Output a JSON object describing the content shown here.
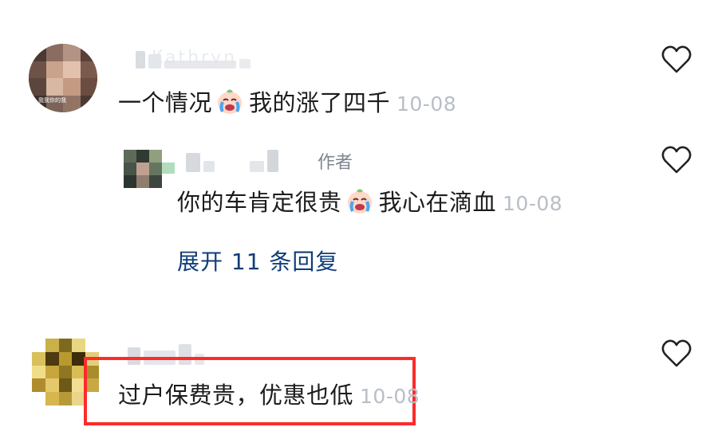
{
  "comments": [
    {
      "username": "Kathryn",
      "text": "一个情况",
      "emoji": "crying-face",
      "text_after": "我的涨了四千",
      "time": "10-08",
      "avatar_caption": "我我你的我"
    },
    {
      "author_label": "作者",
      "text": "你的车肯定很贵",
      "emoji": "crying-face",
      "text_after": "我心在滴血",
      "time": "10-08",
      "expand_label": "展开 11 条回复"
    },
    {
      "text": "过户保费贵，优惠也低",
      "time": "10-08"
    }
  ],
  "colors": {
    "text": "#1c1c1c",
    "timestamp": "#b9bec6",
    "link": "#0f3d78",
    "highlight": "#ff2a2a"
  },
  "icons": [
    "heart-outline-icon",
    "crying-face-emoji"
  ]
}
